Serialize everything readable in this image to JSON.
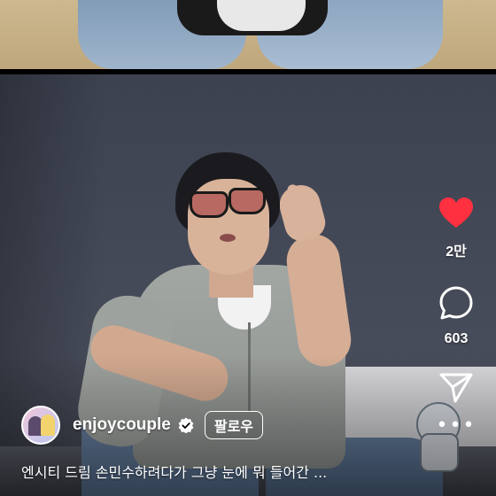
{
  "reel": {
    "author": {
      "username": "enjoycouple",
      "verified": true,
      "follow_label": "팔로우"
    },
    "caption": "엔시티 드림 손민수하려다가 그냥 눈에 뭐 들어간 ...",
    "actions": {
      "like_count": "2만",
      "comment_count": "603"
    }
  },
  "colors": {
    "like_heart": "#ff3040",
    "text": "#ffffff"
  },
  "icons": {
    "like": "heart-icon",
    "comment": "comment-bubble-icon",
    "share": "send-icon",
    "more": "more-dots-icon",
    "verified": "verified-badge-icon"
  }
}
